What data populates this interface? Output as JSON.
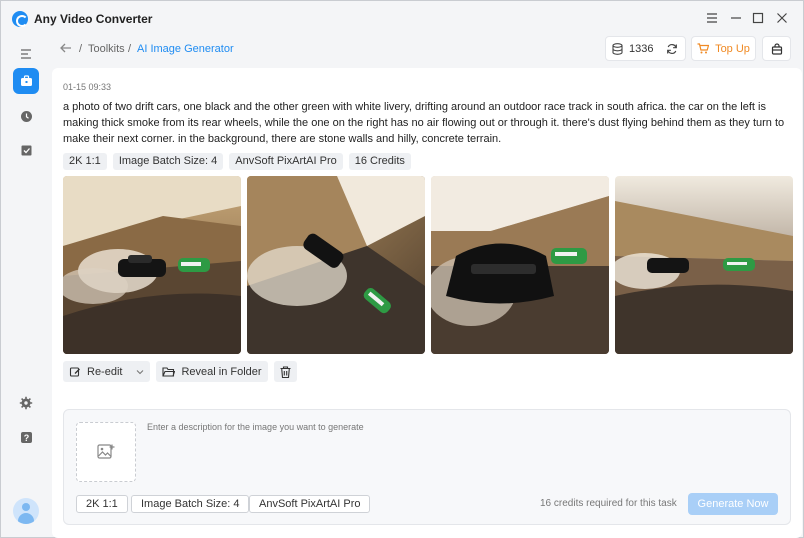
{
  "app": {
    "title": "Any Video Converter"
  },
  "breadcrumb": {
    "root": "Toolkits",
    "separator": "/",
    "current": "AI Image Generator"
  },
  "header": {
    "credits": "1336",
    "topup_label": "Top Up"
  },
  "task": {
    "timestamp": "01-15 09:33",
    "prompt": "a photo of two drift cars, one black and the other green with white livery, drifting around an outdoor race track in south africa. the car on the left is making thick smoke from its rear wheels, while the one on the right has no air flowing out or through it. there's dust flying behind them as they turn to make their next corner. in the background, there are stone walls and hilly, concrete terrain.",
    "tags": [
      "2K 1:1",
      "Image Batch Size: 4",
      "AnvSoft PixArtAI Pro",
      "16 Credits"
    ]
  },
  "actions": {
    "reedit": "Re-edit",
    "reveal": "Reveal in Folder"
  },
  "composer": {
    "placeholder": "Enter a description for the image you want to generate",
    "options": [
      "2K 1:1",
      "Image Batch Size: 4",
      "AnvSoft PixArtAI Pro"
    ],
    "requirement": "16 credits required for this task",
    "generate_label": "Generate Now"
  },
  "colors": {
    "accent": "#1f8cf2",
    "topup": "#f08a24",
    "generate_disabled": "#a9cff7"
  }
}
